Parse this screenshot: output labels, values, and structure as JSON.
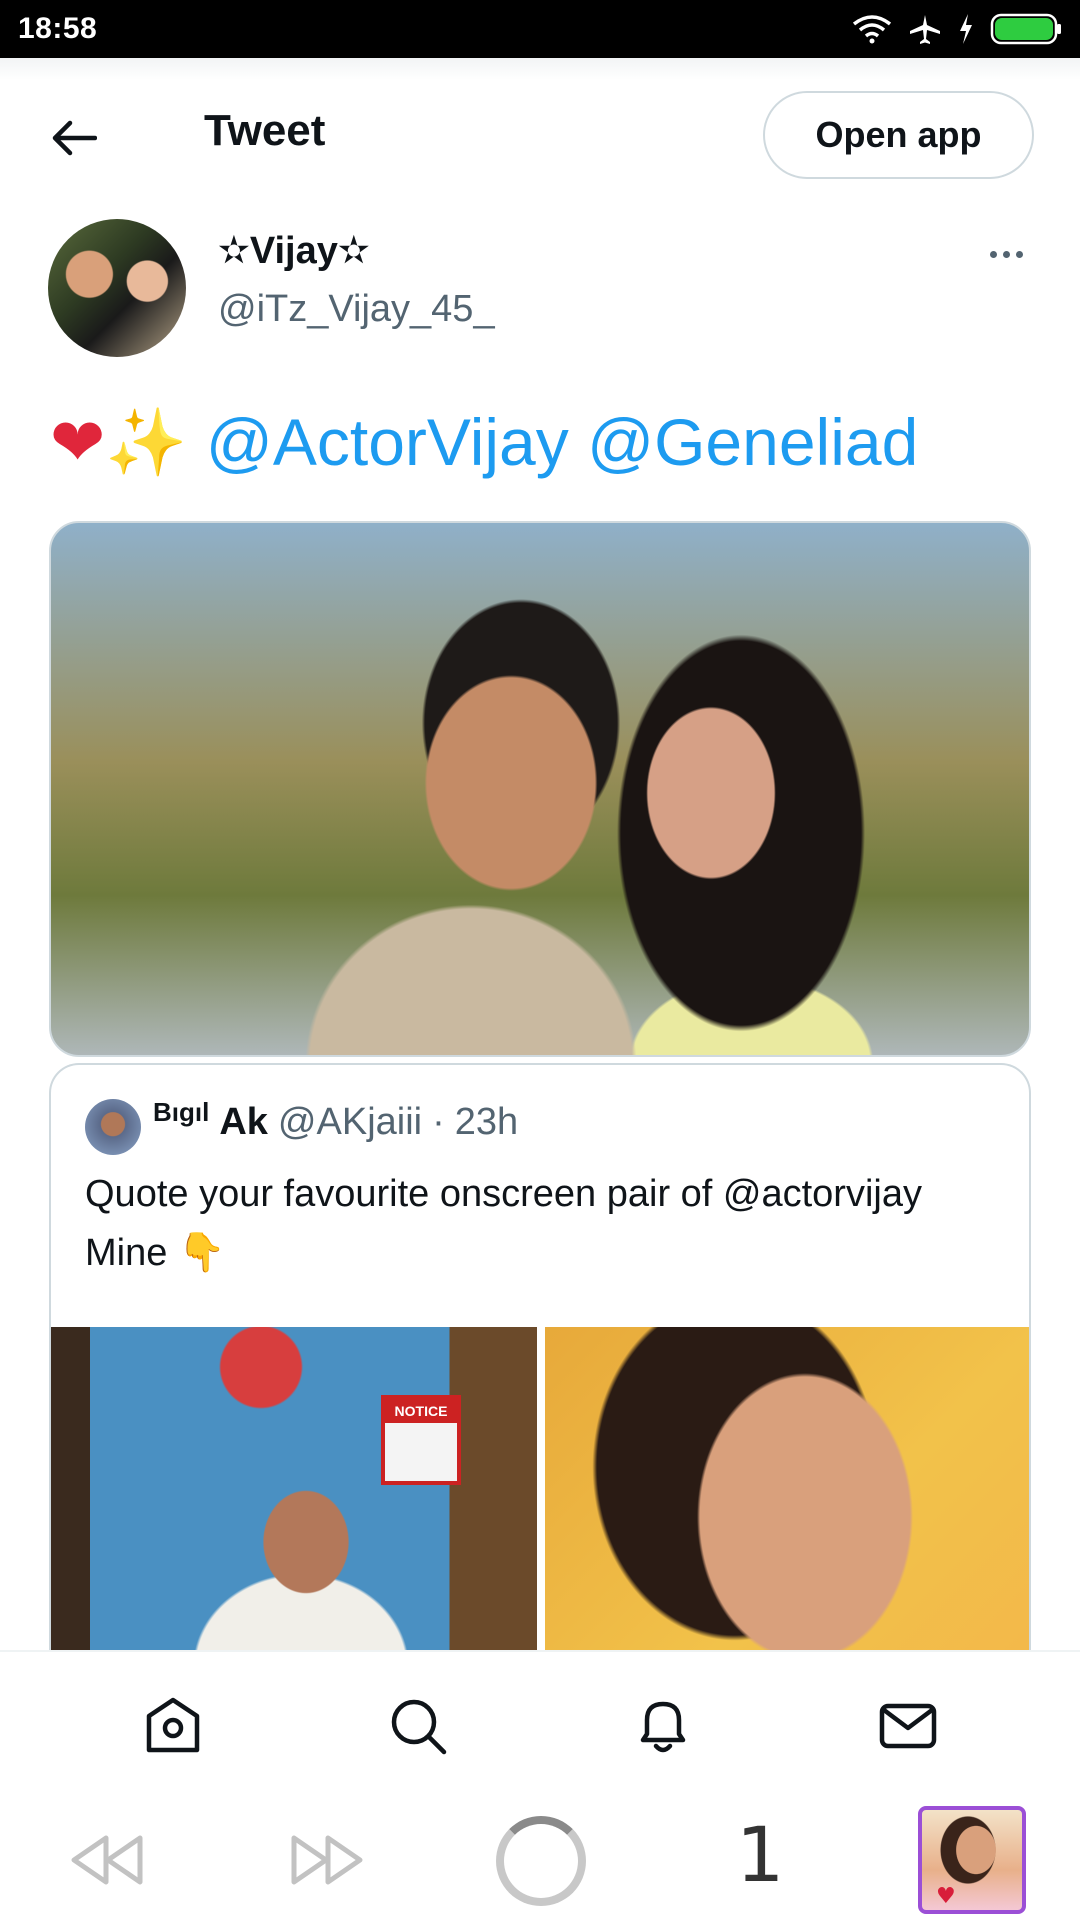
{
  "status_bar": {
    "time": "18:58",
    "icons": [
      "wifi-icon",
      "airplane-icon",
      "charging-icon",
      "battery-icon"
    ],
    "battery_color": "#2ecc40"
  },
  "header": {
    "back_icon": "arrow-left-icon",
    "title": "Tweet",
    "open_app_label": "Open app"
  },
  "tweet": {
    "author_name": "✫Vijay✫",
    "author_handle": "@iTz_Vijay_45_",
    "more_icon": "more-horizontal-icon",
    "emoji_heart": "❤",
    "emoji_sparkles": "✨",
    "mention_1": "@ActorVijay",
    "mention_2": "@Geneliad",
    "mention_color": "#1d9bf0",
    "image_icon": "photo-icon"
  },
  "quoted_tweet": {
    "name_prefix": "Bıgıl",
    "name": "Ak",
    "handle": "@AKjaiii",
    "separator": "·",
    "time": "23h",
    "text": "Quote your favourite onscreen pair of @actorvijay Mine",
    "emoji_point_down": "👇",
    "notice_text": "NOTICE"
  },
  "bottom_nav": {
    "items": [
      "home-icon",
      "search-icon",
      "notifications-icon",
      "messages-icon"
    ]
  },
  "browser_bar": {
    "back_icon": "rewind-icon",
    "forward_icon": "fast-forward-icon",
    "loading_icon": "loading-spinner-icon",
    "tab_count": "1",
    "tab_thumbnail_icon": "tab-thumbnail-icon"
  }
}
